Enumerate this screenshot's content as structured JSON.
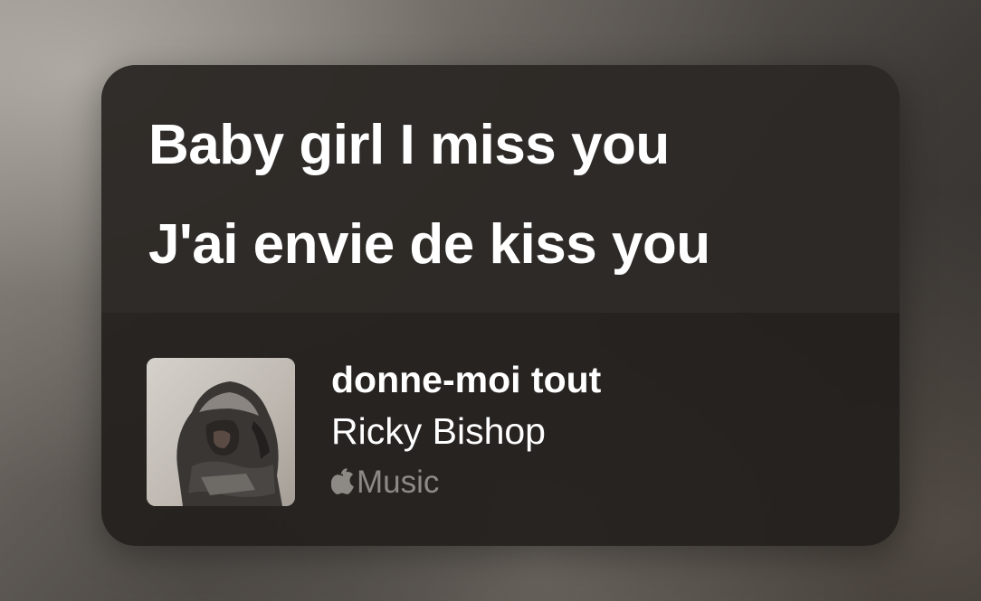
{
  "lyrics": {
    "line1": "Baby girl I miss you",
    "line2": "J'ai envie de kiss you"
  },
  "song": {
    "title": "donne-moi tout",
    "artist": "Ricky Bishop",
    "service_label": "Music",
    "service_icon": "apple-logo-icon",
    "artwork_icon": "album-artwork"
  },
  "colors": {
    "card_background": "#221f1d",
    "text_primary": "#ffffff",
    "text_secondary": "#8d8a86"
  }
}
